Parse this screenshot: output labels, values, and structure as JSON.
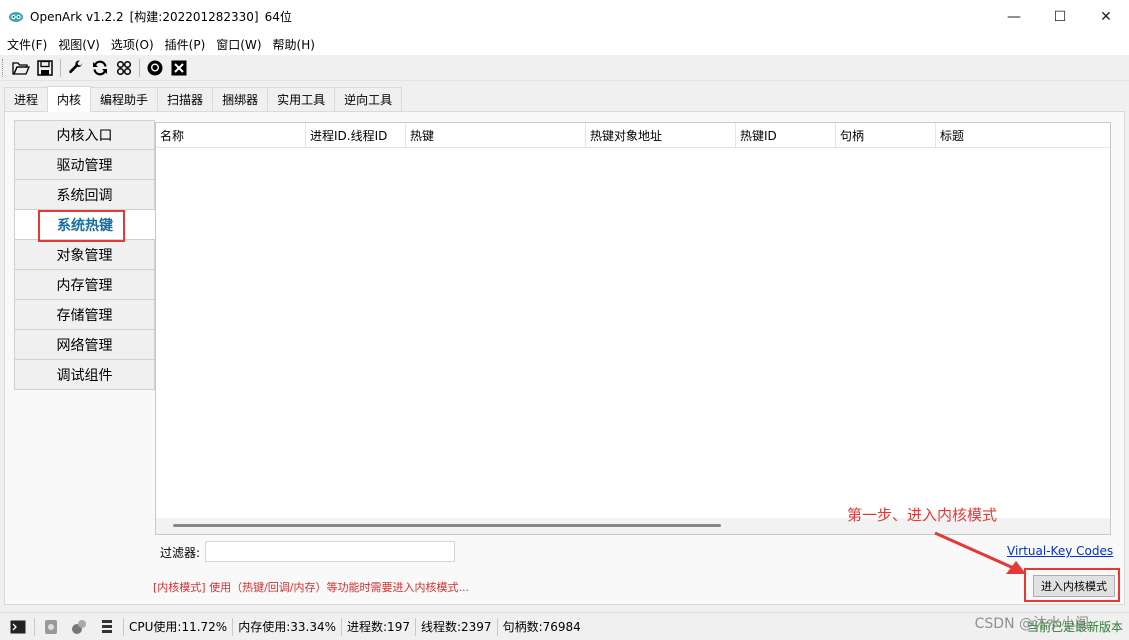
{
  "window": {
    "app_name": "OpenArk v1.2.2",
    "build": "[构建:202201282330]",
    "arch": "64位",
    "minimize": "—",
    "maximize": "☐",
    "close": "✕"
  },
  "menu": [
    "文件(F)",
    "视图(V)",
    "选项(O)",
    "插件(P)",
    "窗口(W)",
    "帮助(H)"
  ],
  "toolbar_icons": [
    "open-folder-icon",
    "save-icon",
    "wrench-icon",
    "refresh-icon",
    "grid-icon",
    "github-icon",
    "close-box-icon"
  ],
  "tabs": [
    "进程",
    "内核",
    "编程助手",
    "扫描器",
    "捆绑器",
    "实用工具",
    "逆向工具"
  ],
  "active_tab": "内核",
  "kernel_nav": [
    "内核入口",
    "驱动管理",
    "系统回调",
    "系统热键",
    "对象管理",
    "内存管理",
    "存储管理",
    "网络管理",
    "调试组件"
  ],
  "active_nav": "系统热键",
  "table": {
    "columns": [
      "名称",
      "进程ID.线程ID",
      "热键",
      "热键对象地址",
      "热键ID",
      "句柄",
      "标题"
    ],
    "rows": []
  },
  "filter": {
    "label": "过滤器:",
    "value": ""
  },
  "link": "Virtual-Key Codes",
  "warning": "[内核模式] 使用（热键/回调/内存）等功能时需要进入内核模式...",
  "kernel_button": "进入内核模式",
  "annotation": "第一步、进入内核模式",
  "status": {
    "cpu": "CPU使用:11.72%",
    "mem": "内存使用:33.34%",
    "procs": "进程数:197",
    "threads": "线程数:2397",
    "handles": "句柄数:76984",
    "update": "当前已是最新版本"
  },
  "watermark": "CSDN @沐水小阁",
  "colors": {
    "accent_red": "#e53935",
    "active_nav_text": "#1a6fa3",
    "link": "#0033cc",
    "status_green": "#2e7d32"
  }
}
